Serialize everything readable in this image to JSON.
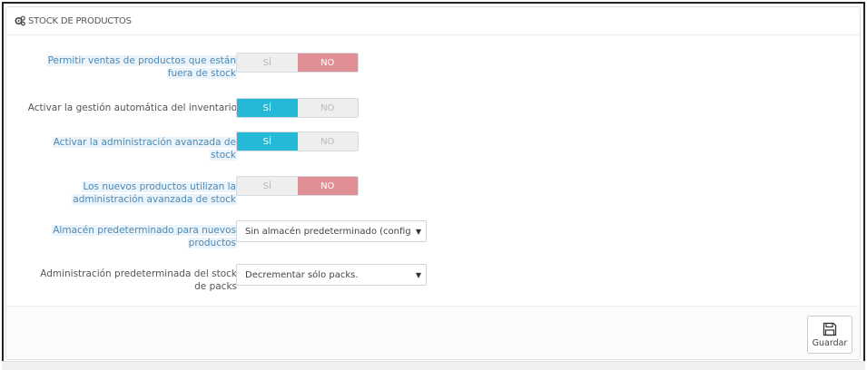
{
  "panel": {
    "title": "STOCK DE PRODUCTOS",
    "title_icon": "cogs-icon"
  },
  "switch_labels": {
    "yes": "SÍ",
    "no": "NO"
  },
  "fields": [
    {
      "label_line1": "Permitir ventas de productos que están",
      "label_line2": "fuera de stock",
      "value": "NO",
      "highlighted": true
    },
    {
      "label_line1": "Activar la gestión automática del inventario",
      "label_line2": "",
      "value": "SÍ",
      "highlighted": false
    },
    {
      "label_line1": "Activar la administración avanzada de",
      "label_line2": "stock",
      "value": "SÍ",
      "highlighted": true
    },
    {
      "label_line1": "Los nuevos productos utilizan la",
      "label_line2": "administración avanzada de stock",
      "value": "NO",
      "highlighted": true
    },
    {
      "label_line1": "Almacén predeterminado para nuevos",
      "label_line2": "productos",
      "selected": "Sin almacén predeterminado (configu",
      "highlighted": true
    },
    {
      "label_line1": "Administración predeterminada del stock",
      "label_line2": "de packs",
      "selected": "Decrementar sólo packs.",
      "highlighted": false
    }
  ],
  "footer": {
    "save_label": "Guardar",
    "save_icon": "floppy-disk-icon"
  },
  "colors": {
    "yes_active": "#25b9d7",
    "no_active": "#e08f95",
    "label_highlight_bg": "#eaf4fa",
    "label_highlight_text": "#4f88b4"
  }
}
